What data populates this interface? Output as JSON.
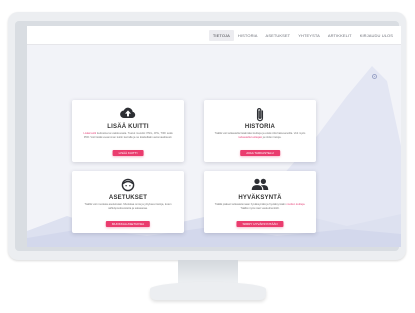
{
  "nav": {
    "items": [
      {
        "label": "TIETOJA",
        "active": true
      },
      {
        "label": "HISTORIA",
        "active": false
      },
      {
        "label": "ASETUKSET",
        "active": false
      },
      {
        "label": "YHTEYSTA",
        "active": false
      },
      {
        "label": "ARTIKKELIT",
        "active": false
      },
      {
        "label": "KIRJAUDU ULOS",
        "active": false
      }
    ]
  },
  "cards": {
    "upload": {
      "icon": "cloud-upload-icon",
      "title": "LISÄÄ KUITTI",
      "text_link": "Lisää kuitti",
      "text": " tiedostoa tai valokuvasta. Tuetut muodot: PNG, JPG, TIFF sekä PDF. Voit lisätä useamman kuitin kerralla ja ne käsitellään automaattisesti.",
      "button": "LISÄÄ KUITTI"
    },
    "history": {
      "icon": "paperclip-icon",
      "title": "HISTORIA",
      "text_pre": "Täällä voit tarkastella lisäämiäsi kuitteja ja etsiä niitä hakusanoilla. Voit myös ",
      "text_link": "tarkastella kuittejasi",
      "text_post": " ja niiden tietoja.",
      "button": "AVAA TARKASTELU"
    },
    "settings": {
      "icon": "face-icon",
      "title": "ASETUKSET",
      "text": "Täällä voit muokata asetuksiasi. Muokkaa omia ja yrityksesi tietoja, kuten sähköpostiosoitetta ja salasanaa.",
      "button": "MUOKKAA ASETUKSIA"
    },
    "approval": {
      "icon": "people-icon",
      "title": "HYVÄKSYNTÄ",
      "text_pre": "Täällä pääset tarkastelemaan hyväksyntää ja hyväksymään ",
      "text_link": "muiden kuitteja",
      "text_post": ". Täällä myös näet vastuuhenkilöt.",
      "button": "SIIRRY HYVÄKSYNTÄÄN"
    }
  },
  "colors": {
    "accent": "#ea3c6e",
    "link": "#e5457b",
    "screen_bg": "#f2f3f8",
    "wave": "#dfe3f2"
  }
}
